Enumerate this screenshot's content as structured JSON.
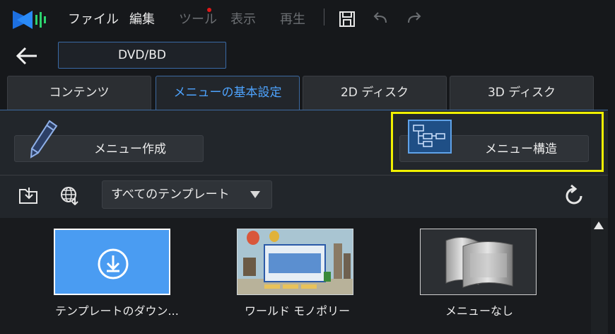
{
  "menu": {
    "items": [
      {
        "label": "ファイル",
        "enabled": true
      },
      {
        "label": "編集",
        "enabled": true
      },
      {
        "label": "ツール",
        "enabled": false
      },
      {
        "label": "表示",
        "enabled": false
      },
      {
        "label": "再生",
        "enabled": false
      }
    ],
    "toolbar_icons": [
      "save-icon",
      "undo-icon",
      "redo-icon"
    ]
  },
  "header": {
    "title": "DVD/BD"
  },
  "tabs": [
    {
      "label": "コンテンツ",
      "active": false
    },
    {
      "label": "メニューの基本設定",
      "active": true
    },
    {
      "label": "2D ディスク",
      "active": false
    },
    {
      "label": "3D ディスク",
      "active": false
    }
  ],
  "actions": {
    "create_label": "メニュー作成",
    "structure_label": "メニュー構造"
  },
  "filter": {
    "selected": "すべてのテンプレート"
  },
  "templates": [
    {
      "label": "テンプレートのダウン..."
    },
    {
      "label": "ワールド モノポリー"
    },
    {
      "label": "メニューなし"
    }
  ],
  "colors": {
    "accent": "#4ea4ff",
    "highlight": "#f0f000",
    "download_tile": "#4a9cf2"
  }
}
